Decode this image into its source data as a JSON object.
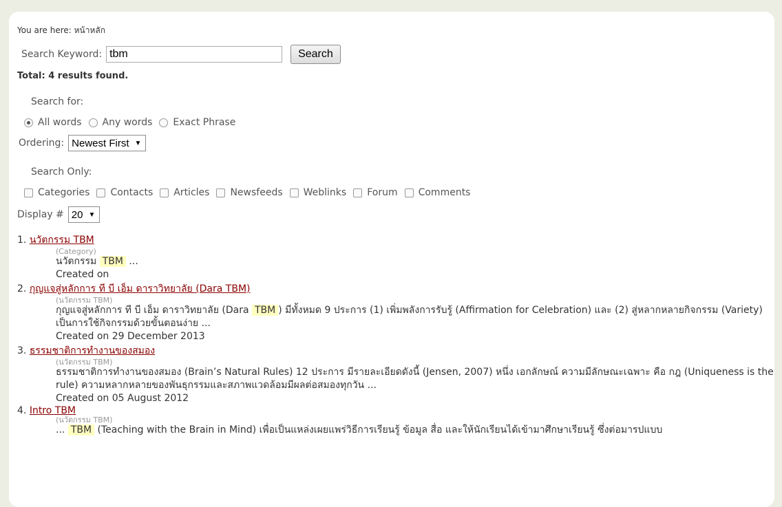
{
  "breadcrumb": "You are here: หน้าหลัก",
  "search": {
    "label": "Search Keyword:",
    "value": "tbm",
    "button": "Search"
  },
  "total": "Total: 4 results found.",
  "search_for": {
    "label": "Search for:",
    "options": [
      "All words",
      "Any words",
      "Exact Phrase"
    ],
    "selected": "All words"
  },
  "ordering": {
    "label": "Ordering:",
    "value": "Newest First"
  },
  "search_only": {
    "label": "Search Only:",
    "options": [
      "Categories",
      "Contacts",
      "Articles",
      "Newsfeeds",
      "Weblinks",
      "Forum",
      "Comments"
    ]
  },
  "display": {
    "label": "Display #",
    "value": "20"
  },
  "results": [
    {
      "num": "1.",
      "title": "นวัตกรรม TBM",
      "meta": "(Category)",
      "snippet_pre": "นวัตกรรม ",
      "snippet_hl": "TBM",
      "snippet_post": " ...",
      "created": "Created on"
    },
    {
      "num": "2.",
      "title": "กุญแจสู่หลักการ ที บี เอ็ม ดาราวิทยาลัย (Dara TBM)",
      "meta": "(นวัตกรรม TBM)",
      "snippet_pre": "กุญแจสู่หลักการ ที บี เอ็ม ดาราวิทยาลัย (Dara ",
      "snippet_hl": "TBM",
      "snippet_post": ") มีทั้งหมด 9 ประการ   (1) เพิ่มพลังการรับรู้ (Affirmation for Celebration) และ (2) สู่หลากหลายกิจกรรม (Variety) เป็นการใช้กิจกรรมด้วยขั้นตอนง่าย ...",
      "created": "Created on 29 December 2013"
    },
    {
      "num": "3.",
      "title": "ธรรมชาติการทำงานของสมอง",
      "meta": "(นวัตกรรม TBM)",
      "snippet_pre": "ธรรมชาติการทำงานของสมอง (Brain’s Natural Rules) 12 ประการ มีรายละเอียดดังนี้ (Jensen, 2007)            หนึ่ง เอกลักษณ์  ความมีลักษณะเฉพาะ คือ กฎ (Uniqueness is the rule) ความหลากหลายของพันธุกรรมและสภาพแวดล้อมมีผลต่อสมองทุกวัน ...",
      "snippet_hl": "",
      "snippet_post": "",
      "created": "Created on 05 August 2012"
    },
    {
      "num": "4.",
      "title": "Intro TBM",
      "meta": "(นวัตกรรม TBM)",
      "snippet_pre": "... ",
      "snippet_hl": "TBM",
      "snippet_post": " (Teaching with the Brain in Mind) เพื่อเป็นแหล่งเผยแพร่วิธีการเรียนรู้ ข้อมูล สื่อ และให้นักเรียนได้เข้ามาศึกษาเรียนรู้ ซึ่งต่อมารปแบบ",
      "created": ""
    }
  ]
}
